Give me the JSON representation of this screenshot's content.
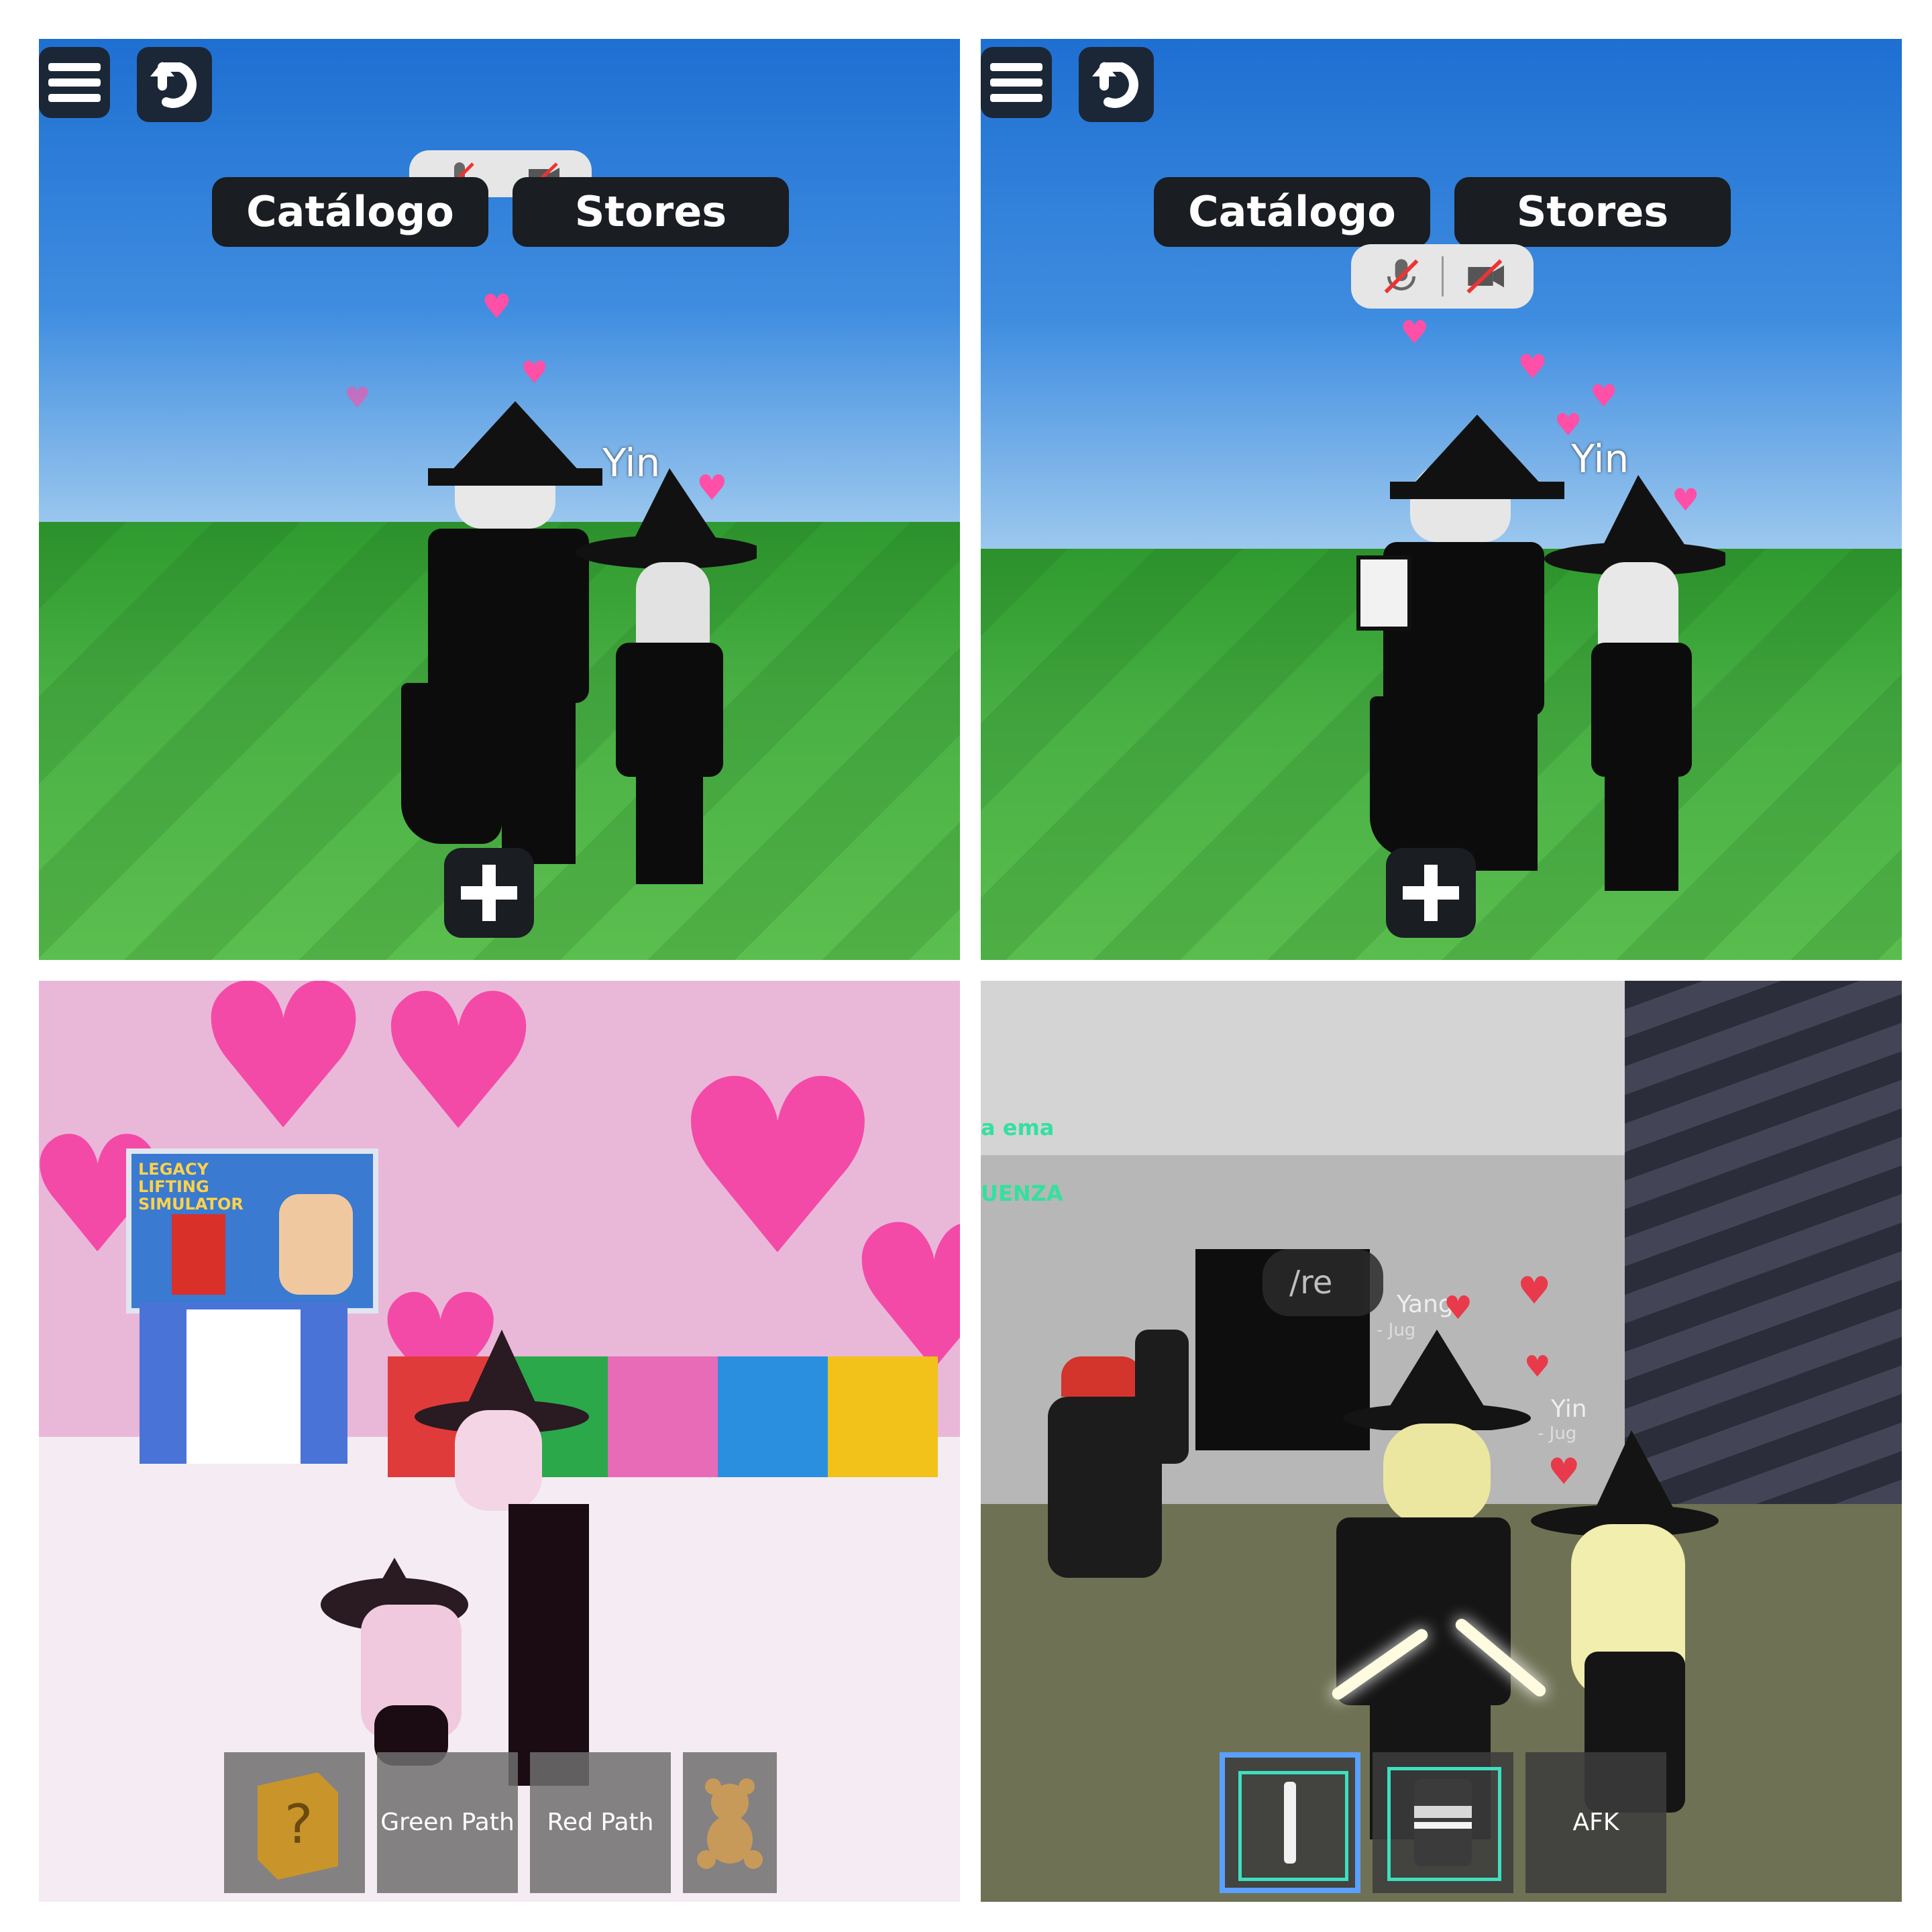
{
  "panels": {
    "top_left": {
      "tabs": [
        "Catálogo",
        "Stores"
      ],
      "player_name": "Yin"
    },
    "top_right": {
      "tabs": [
        "Catálogo",
        "Stores"
      ],
      "player_name": "Yin"
    },
    "bottom_left": {
      "hotbar": [
        "",
        "Green Path",
        "Red Path",
        ""
      ],
      "billboard_text": "LEGACY LIFTING SIMULATOR"
    },
    "bottom_right": {
      "hotbar": [
        "",
        "",
        "AFK"
      ],
      "chat_lines": [
        "a ema",
        "UENZA"
      ],
      "chat_bubble": "/re",
      "name_tags": [
        "Yang",
        "Yin"
      ],
      "sub_tags": [
        "- Jug",
        "- Jug"
      ]
    }
  },
  "icons": [
    "menu-icon",
    "undo-icon",
    "plus-icon",
    "mic-muted-icon",
    "camera-off-icon",
    "heart-icon",
    "mystery-block-icon",
    "teddy-bear-icon"
  ],
  "colors": {
    "sky": "#1e6fd2",
    "grass": "#49b044",
    "tab_bg": "#1a1d22",
    "heart": "#ff4fa7",
    "selected_slot": "#5aa0ff",
    "slot_outline": "#3de0c0"
  }
}
